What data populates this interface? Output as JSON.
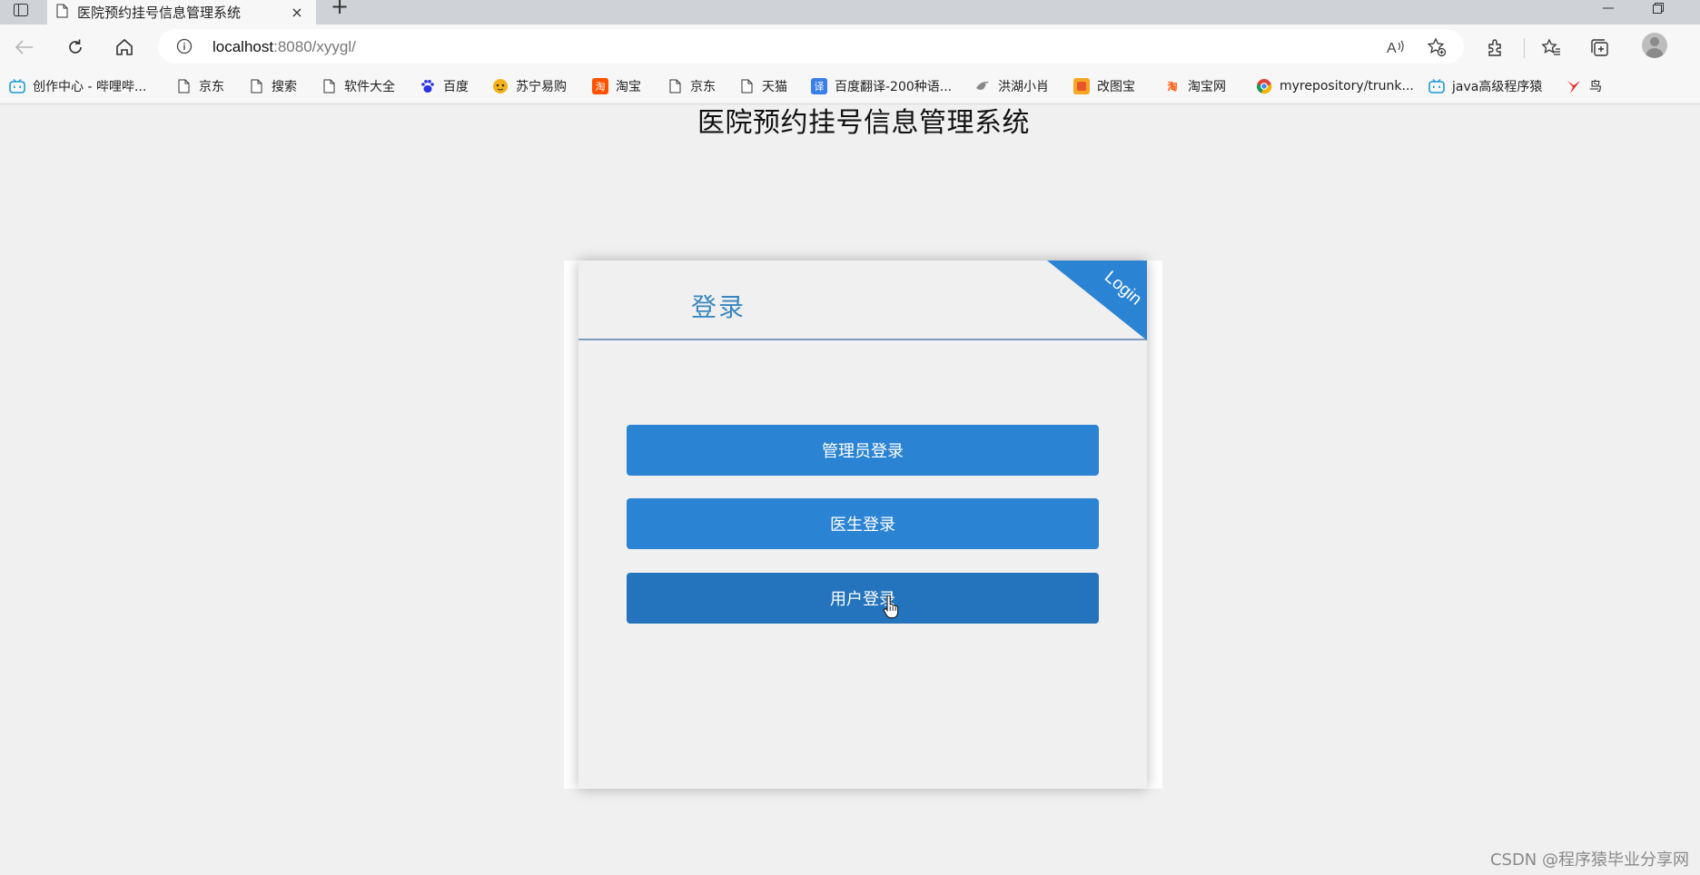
{
  "browser": {
    "tab_title": "医院预约挂号信息管理系统",
    "tab_close": "×",
    "new_tab": "+",
    "url_host": "localhost",
    "url_rest": ":8080/xyygl/",
    "bookmarks": [
      {
        "label": "创作中心 - 哔哩哔...",
        "icon": "bilibili-icon"
      },
      {
        "label": "京东",
        "icon": "page-icon"
      },
      {
        "label": "搜索",
        "icon": "page-icon"
      },
      {
        "label": "软件大全",
        "icon": "page-icon"
      },
      {
        "label": "百度",
        "icon": "baidu-icon"
      },
      {
        "label": "苏宁易购",
        "icon": "suning-icon"
      },
      {
        "label": "淘宝",
        "icon": "taobao-icon"
      },
      {
        "label": "京东",
        "icon": "page-icon"
      },
      {
        "label": "天猫",
        "icon": "page-icon"
      },
      {
        "label": "百度翻译-200种语...",
        "icon": "translate-icon"
      },
      {
        "label": "洪湖小肖",
        "icon": "bird-icon"
      },
      {
        "label": "改图宝",
        "icon": "gaitubao-icon"
      },
      {
        "label": "淘宝网",
        "icon": "taobao-icon"
      },
      {
        "label": "myrepository/trunk...",
        "icon": "chrome-icon"
      },
      {
        "label": "java高级程序猿",
        "icon": "bilibili-icon"
      },
      {
        "label": "鸟",
        "icon": "bird-red-icon"
      }
    ]
  },
  "page": {
    "title": "医院预约挂号信息管理系统",
    "card": {
      "heading": "登录",
      "corner_label": "Login",
      "buttons": {
        "admin": "管理员登录",
        "doctor": "医生登录",
        "user": "用户登录"
      }
    }
  },
  "watermark": "CSDN @程序猿毕业分享网",
  "colors": {
    "accent": "#2b83d3",
    "accent_hover": "#2474bd",
    "heading": "#3a87c0",
    "page_bg": "#f0f0f0"
  }
}
